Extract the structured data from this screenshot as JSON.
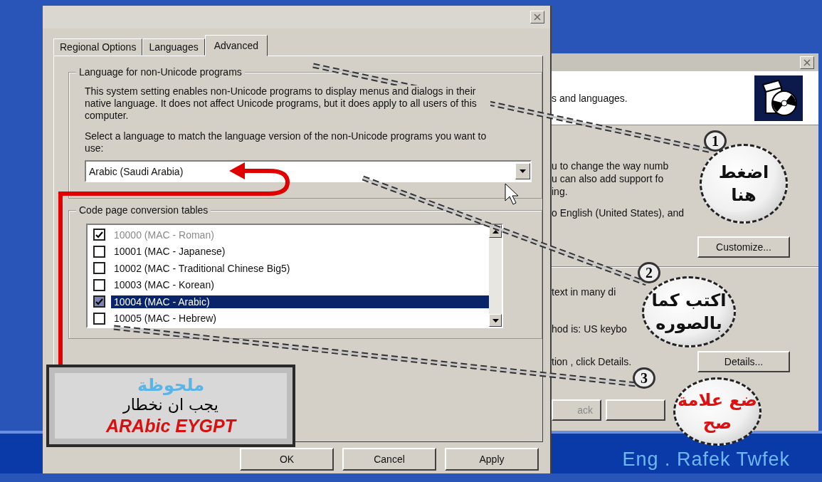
{
  "dialog": {
    "tabs": [
      {
        "label": "Regional Options",
        "selected": false
      },
      {
        "label": "Languages",
        "selected": false
      },
      {
        "label": "Advanced",
        "selected": true
      }
    ],
    "language_group": {
      "title": "Language for non-Unicode programs",
      "description": "This system setting enables non-Unicode programs to display menus and dialogs in their native language. It does not affect Unicode programs, but it does apply to all users of this computer.",
      "prompt": "Select a language to match the language version of the non-Unicode programs you want to use:",
      "dropdown_value": "Arabic (Saudi Arabia)"
    },
    "code_page_group": {
      "title": "Code page conversion tables",
      "items": [
        {
          "label": "10000 (MAC - Roman)",
          "checked": true,
          "disabled": true,
          "selected": false
        },
        {
          "label": "10001 (MAC - Japanese)",
          "checked": false,
          "disabled": false,
          "selected": false
        },
        {
          "label": "10002 (MAC - Traditional Chinese Big5)",
          "checked": false,
          "disabled": false,
          "selected": false
        },
        {
          "label": "10003 (MAC - Korean)",
          "checked": false,
          "disabled": false,
          "selected": false
        },
        {
          "label": "10004 (MAC - Arabic)",
          "checked": true,
          "disabled": false,
          "selected": true
        },
        {
          "label": "10005 (MAC - Hebrew)",
          "checked": false,
          "disabled": false,
          "selected": false
        }
      ]
    },
    "buttons": [
      "OK",
      "Cancel",
      "Apply"
    ]
  },
  "back_window": {
    "header_text": "s and languages.",
    "lines": [
      "u to change the way numb",
      "u can also add support fo",
      "ing."
    ],
    "language_line": "o English (United States), and",
    "customize_button": "Customize...",
    "text_line": "text in many di",
    "input_line": "hod is: US keybo",
    "details_line": "tion , click Details.",
    "details_button": "Details...",
    "back_button": "ack"
  },
  "note": {
    "title": "ملحوظة",
    "text": "يجب ان نخطار",
    "highlight": "ARAbic EYGPT"
  },
  "callouts": [
    {
      "number": "1",
      "lines": [
        "اضغط",
        "هنا"
      ],
      "color": "#111111"
    },
    {
      "number": "2",
      "lines": [
        "اكتب كما",
        "بالصوره"
      ],
      "color": "#111111"
    },
    {
      "number": "3",
      "lines": [
        "ضع علامة",
        "صح"
      ],
      "color": "#e01010"
    }
  ],
  "credit": "Eng . Rafek Twfek"
}
